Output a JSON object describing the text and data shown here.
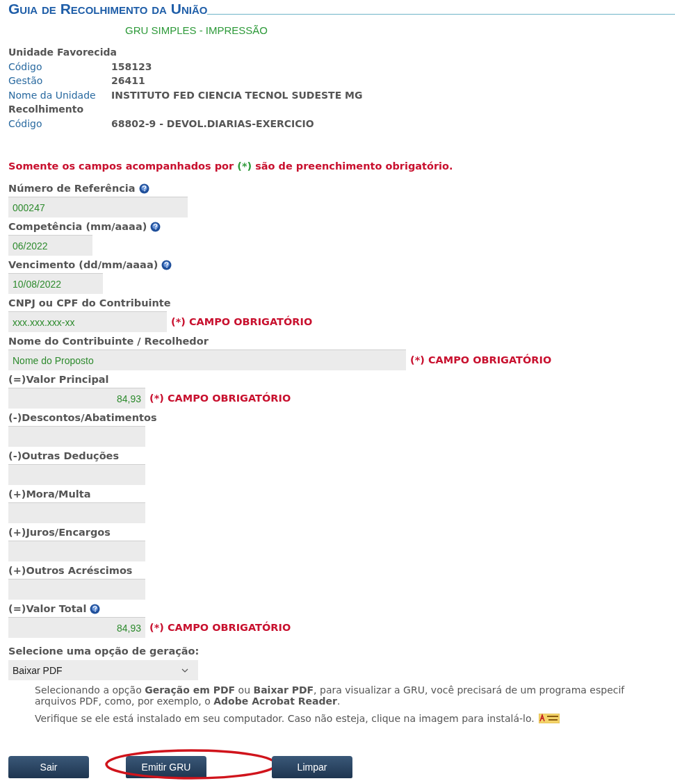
{
  "header": {
    "title": "Guia de Recolhimento da União",
    "subtitle": "GRU SIMPLES - IMPRESSÃO"
  },
  "info": [
    {
      "kind": "section",
      "label": "Unidade Favorecida"
    },
    {
      "kind": "row",
      "label": "Código",
      "value": "158123"
    },
    {
      "kind": "row",
      "label": "Gestão",
      "value": "26411"
    },
    {
      "kind": "row",
      "label": "Nome da Unidade",
      "value": "INSTITUTO FED CIENCIA TECNOL SUDESTE MG"
    },
    {
      "kind": "section",
      "label": "Recolhimento"
    },
    {
      "kind": "row",
      "label": "Código",
      "value": "68802-9 - DEVOL.DIARIAS-EXERCICIO"
    }
  ],
  "notice": "Somente os campos acompanhados por **(*)** são de preenchimento obrigatório.",
  "fields": [
    {
      "kind": "reference",
      "label": "Número de Referência",
      "help": true,
      "value": "000247"
    },
    {
      "kind": "month",
      "label": "Competência (mm/aaaa)",
      "help": true,
      "value": "06/2022"
    },
    {
      "kind": "date",
      "label": "Vencimento (dd/mm/aaaa)",
      "help": true,
      "value": "10/08/2022"
    },
    {
      "kind": "document",
      "label": "CNPJ ou CPF do Contribuinte",
      "help": false,
      "value": "xxx.xxx.xxx-xx",
      "required_note": "(*) CAMPO OBRIGATÓRIO"
    },
    {
      "kind": "name",
      "label": "Nome do Contribuinte / Recolhedor",
      "help": false,
      "value": "Nome do Proposto",
      "required_note": "(*) CAMPO OBRIGATÓRIO"
    },
    {
      "kind": "amount",
      "label": "(=)Valor Principal",
      "help": false,
      "value": "84,93",
      "required_note": "(*) CAMPO OBRIGATÓRIO"
    },
    {
      "kind": "amount",
      "label": "(-)Descontos/Abatimentos",
      "help": false
    },
    {
      "kind": "amount",
      "label": "(-)Outras Deduções",
      "help": false
    },
    {
      "kind": "amount",
      "label": "(+)Mora/Multa",
      "help": false
    },
    {
      "kind": "amount",
      "label": "(+)Juros/Encargos",
      "help": false
    },
    {
      "kind": "amount",
      "label": "(+)Outros Acréscimos",
      "help": false
    },
    {
      "kind": "amount",
      "label": "(=)Valor Total",
      "help": true,
      "value": "84,93",
      "required_note": "(*) CAMPO OBRIGATÓRIO"
    }
  ],
  "generation": {
    "label": "Selecione uma opção de geração:",
    "value": "Baixar PDF",
    "info_lines": [
      "Selecionando a opção **Geração em PDF** ou **Baixar PDF**, para visualizar a GRU, você precisará de um programa especif",
      "arquivos PDF, como, por exemplo, o **Adobe Acrobat Reader**."
    ],
    "install_note": "Verifique se ele está instalado em seu computador. Caso não esteja, clique na imagem para instalá-lo."
  },
  "buttons": [
    {
      "label": "Sair",
      "highlighted": false
    },
    {
      "label": "Emitir GRU",
      "highlighted": true
    },
    {
      "label": "Limpar",
      "highlighted": false
    }
  ]
}
